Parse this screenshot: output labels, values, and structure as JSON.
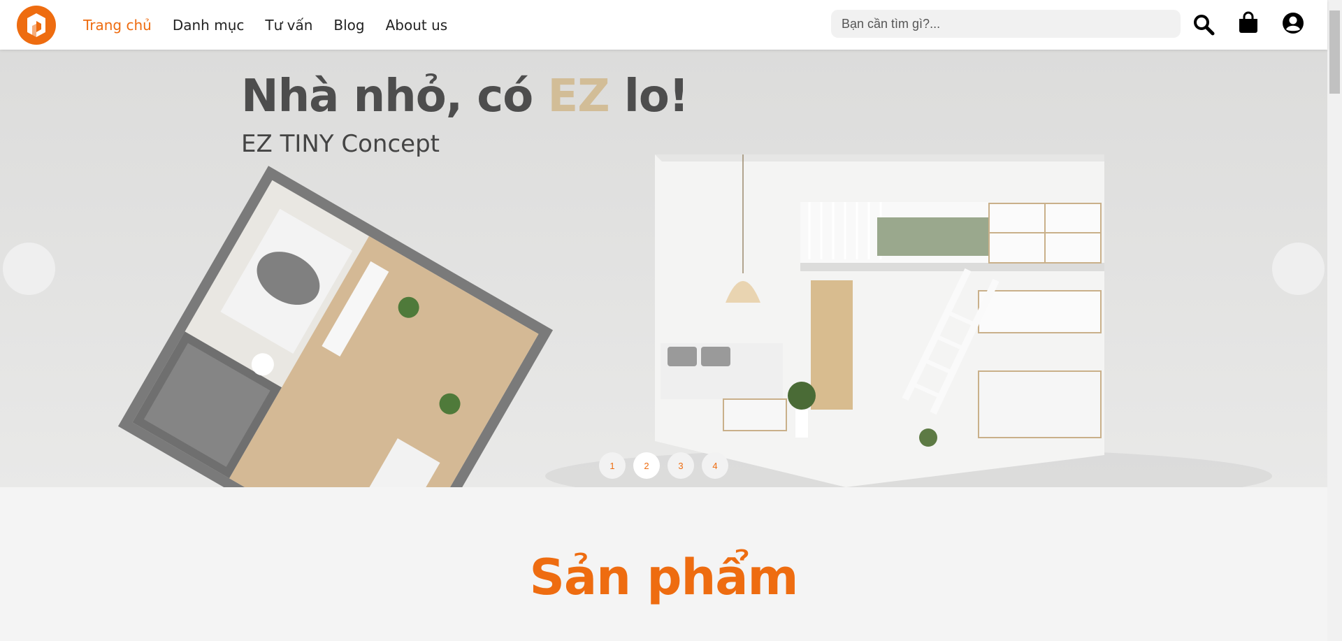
{
  "brand": {
    "accent_color": "#ee6c10",
    "logo_icon": "ez-logo-icon"
  },
  "nav": [
    {
      "label": "Trang chủ",
      "active": true
    },
    {
      "label": "Danh mục",
      "active": false
    },
    {
      "label": "Tư vấn",
      "active": false
    },
    {
      "label": "Blog",
      "active": false
    },
    {
      "label": "About us",
      "active": false
    }
  ],
  "search": {
    "placeholder": "Bạn cần tìm gì?...",
    "value": ""
  },
  "header_icons": [
    "search-icon",
    "shopping-bag-icon",
    "user-account-icon"
  ],
  "hero": {
    "title_part1": "Nhà nhỏ, có ",
    "title_accent": "EZ",
    "title_part2": " lo!",
    "accent_color": "#d2bd97",
    "subtitle": "EZ TINY Concept",
    "slides": [
      "1",
      "2",
      "3",
      "4"
    ],
    "active_slide": 2
  },
  "products": {
    "title": "Sản phẩm"
  }
}
